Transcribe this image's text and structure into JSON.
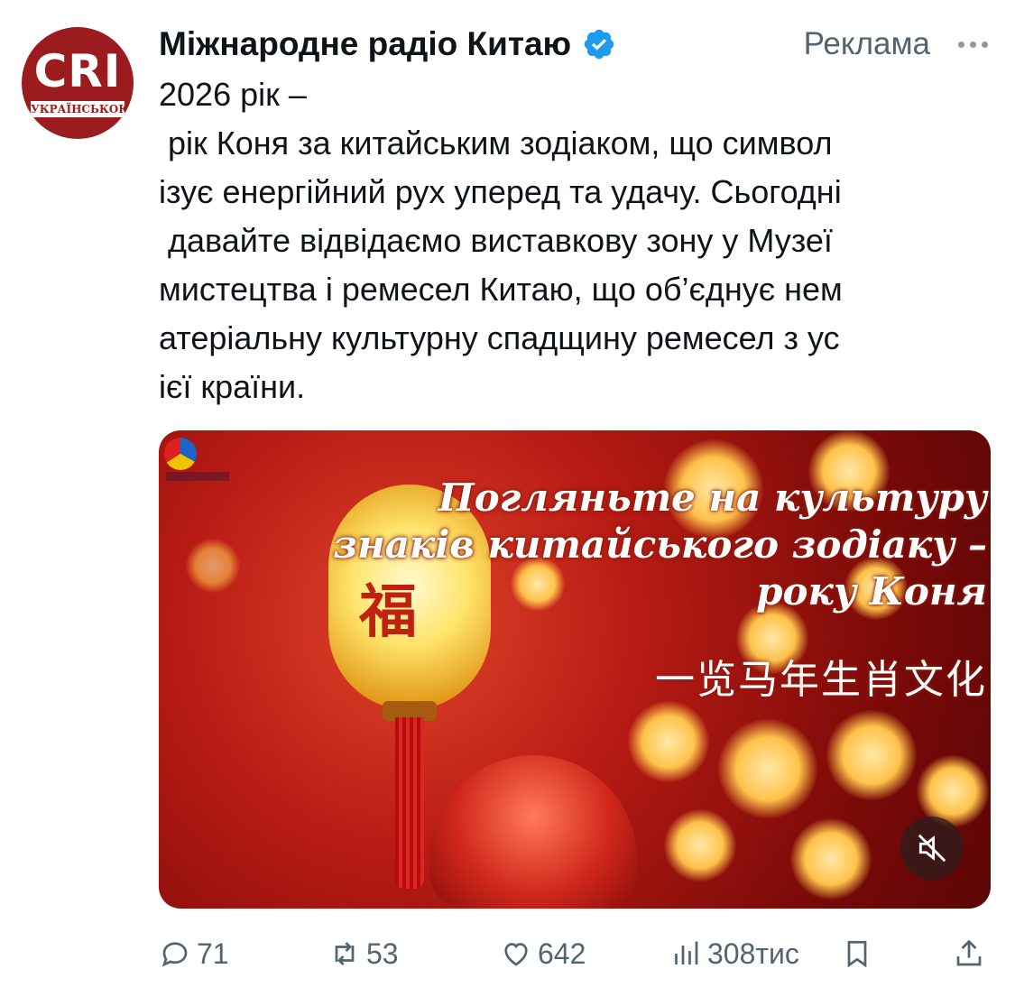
{
  "account": {
    "name": "Міжнародне радіо Китаю",
    "avatar_logo": "CRI",
    "avatar_sub": "УКРАЇНСЬКОЮ",
    "verified_icon": "verified-badge-icon",
    "ad_label": "Реклама"
  },
  "post": {
    "text": "2026 рік –\n рік Коня за китайським зодіаком, що символ\nізує енергійний рух уперед та удачу. Сьогодні\n давайте відвідаємо виставкову зону у Музеї\nмистецтва і ремесел Китаю, що об’єднує нем\nатеріальну культурну спадщину ремесел з ус\nієї країни."
  },
  "media": {
    "title_line1": "Погляньте на культуру",
    "title_line2": "знаків китайського зодіаку –",
    "title_line3": "року Коня",
    "title_chinese": "一览马年生肖文化",
    "lantern_char": "福",
    "mute_icon": "speaker-muted-icon"
  },
  "actions": {
    "replies": "71",
    "retweets": "53",
    "likes": "642",
    "views": "308тис"
  },
  "colors": {
    "accent_blue": "#1d9bf0",
    "secondary_text": "#536471",
    "brand_red": "#9c1b1e"
  }
}
